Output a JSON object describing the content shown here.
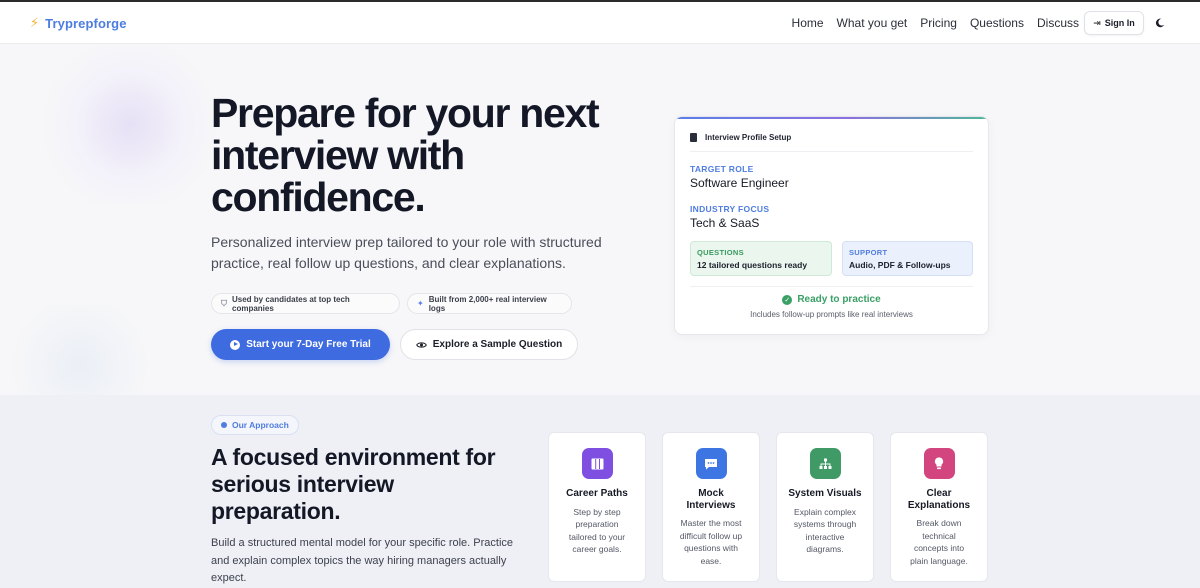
{
  "brand": {
    "name": "Tryprepforge",
    "icon": "bolt-icon"
  },
  "nav": {
    "links": [
      "Home",
      "What you get",
      "Pricing",
      "Questions",
      "Discuss"
    ],
    "signin_label": "Sign In",
    "theme_icon": "moon-icon"
  },
  "hero": {
    "title": "Prepare for your next interview with confidence.",
    "subtitle": "Personalized interview prep tailored to your role with structured practice, real follow up questions, and clear explanations.",
    "pills": [
      "Used by candidates at top tech companies",
      "Built from 2,000+ real interview logs"
    ],
    "primary_cta": "Start your 7-Day Free Trial",
    "secondary_cta": "Explore a Sample Question"
  },
  "profile_card": {
    "header": "Interview Profile Setup",
    "target_role_label": "TARGET ROLE",
    "target_role": "Software Engineer",
    "industry_label": "INDUSTRY FOCUS",
    "industry": "Tech & SaaS",
    "questions_label": "QUESTIONS",
    "questions_value": "12 tailored questions ready",
    "support_label": "SUPPORT",
    "support_value": "Audio, PDF & Follow-ups",
    "status": "Ready to practice",
    "status_sub": "Includes follow-up prompts like real interviews"
  },
  "approach": {
    "badge": "Our Approach",
    "title": "A focused environment for serious interview preparation.",
    "subtitle": "Build a structured mental model for your specific role. Practice and explain complex topics the way hiring managers actually expect.",
    "features": [
      {
        "title": "Career Paths",
        "desc": "Step by step preparation tailored to your career goals.",
        "icon": "map-icon"
      },
      {
        "title": "Mock Interviews",
        "desc": "Master the most difficult follow up questions with ease.",
        "icon": "chat-icon"
      },
      {
        "title": "System Visuals",
        "desc": "Explain complex systems through interactive diagrams.",
        "icon": "sitemap-icon"
      },
      {
        "title": "Clear Explanations",
        "desc": "Break down technical concepts into plain language.",
        "icon": "lightbulb-icon"
      }
    ]
  },
  "colors": {
    "accent": "#3e6be0",
    "brand": "#4d7de0",
    "success": "#3aa065"
  }
}
